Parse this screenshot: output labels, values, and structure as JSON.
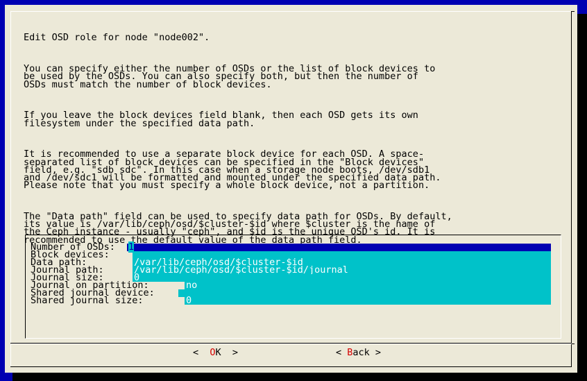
{
  "dialog": {
    "title_line": "Edit OSD role for node \"node002\".",
    "paragraphs": [
      "You can specify either the number of OSDs or the list of block devices to\nbe used by the OSDs. You can also specify both, but then the number of\nOSDs must match the number of block devices.",
      "If you leave the block devices field blank, then each OSD gets its own\nfilesystem under the specified data path.",
      "It is recommended to use a separate block device for each OSD. A space-\nseparated list of block devices can be specified in the \"Block devices\"\nfield, e.g. \"sdb sdc\". In this case when a storage node boots, /dev/sdb1\nand /dev/sdc1 will be formatted and mounted under the specified data path.\nPlease note that you must specify a whole block device, not a partition.",
      "The \"Data path\" field can be used to specify data path for OSDs. By default,\nits value is /var/lib/ceph/osd/$cluster-$id where $cluster is the name of\nthe Ceph instance - usually \"ceph\", and $id is the unique OSD's id. It is\nrecommended to use the default value of the data path field."
    ]
  },
  "form": {
    "fields": [
      {
        "label": "Number of OSDs:",
        "value": "1"
      },
      {
        "label": "Block devices:",
        "value": ""
      },
      {
        "label": "Data path:",
        "value": "/var/lib/ceph/osd/$cluster-$id"
      },
      {
        "label": "Journal path:",
        "value": "/var/lib/ceph/osd/$cluster-$id/journal"
      },
      {
        "label": "Journal size:",
        "value": "0"
      },
      {
        "label": "Journal on partition:",
        "value": "no"
      },
      {
        "label": "Shared journal device:",
        "value": ""
      },
      {
        "label": "Shared journal size:",
        "value": "0"
      }
    ]
  },
  "buttons": {
    "ok": {
      "open": "<  ",
      "hot": "O",
      "rest": "K",
      "close": "  >"
    },
    "back": {
      "open": "< ",
      "hot": "B",
      "rest": "ack",
      "close": " >"
    }
  },
  "colors": {
    "background": "#0000b2",
    "dialog": "#ece9d8",
    "field": "#00c2c9",
    "hotkey": "#d40000"
  }
}
